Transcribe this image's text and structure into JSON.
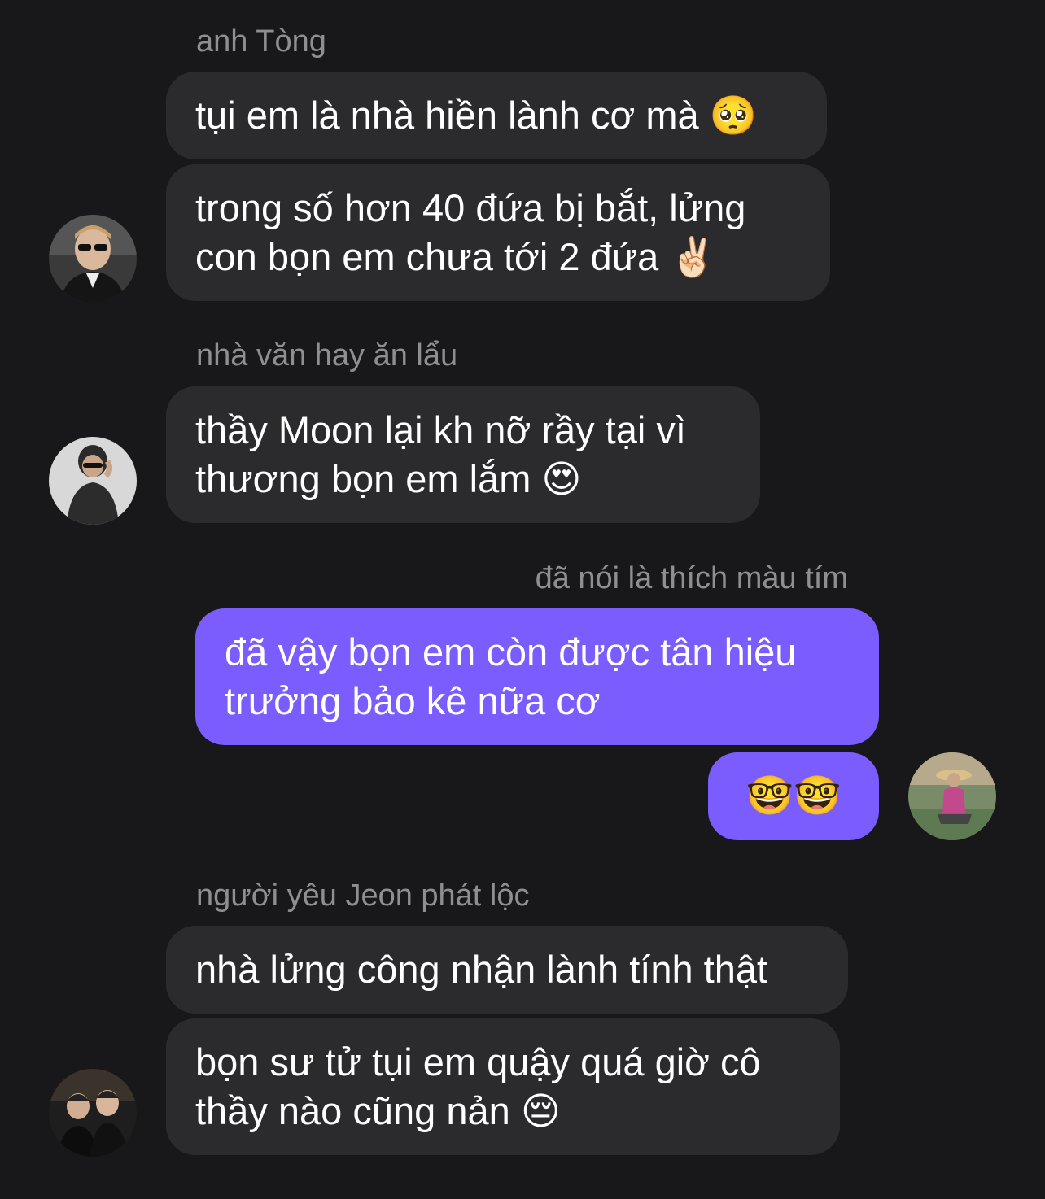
{
  "messages": [
    {
      "sender": "anh Tòng",
      "bubbles": [
        {
          "lines": [
            "tụi em là nhà hiền lành cơ mà 🥺"
          ]
        },
        {
          "lines": [
            "trong số hơn 40 đứa bị bắt, lửng",
            "con bọn em chưa tới 2 đứa ✌🏻"
          ]
        }
      ]
    },
    {
      "sender": "nhà văn hay ăn lẩu",
      "bubbles": [
        {
          "lines": [
            "thầy Moon lại kh nỡ rầy tại vì",
            "thương bọn em lắm 😍"
          ]
        }
      ]
    },
    {
      "sender": "đã nói là thích màu tím",
      "outgoing": true,
      "bubbles": [
        {
          "lines": [
            "đã vậy bọn em còn được tân hiệu",
            "trưởng bảo kê nữa cơ"
          ]
        },
        {
          "lines": [
            "🤓🤓"
          ]
        }
      ]
    },
    {
      "sender": "người yêu Jeon phát lộc",
      "bubbles": [
        {
          "lines": [
            "nhà lửng công nhận lành tính thật"
          ]
        },
        {
          "lines": [
            "bọn sư tử tụi em quậy quá giờ cô",
            "thầy nào cũng nản 😔"
          ]
        }
      ]
    }
  ],
  "colors": {
    "background": "#18181b",
    "incoming_bubble": "#2b2b2e",
    "outgoing_bubble": "#7b5cff",
    "sender_text": "#8e8e93",
    "message_text": "#ffffff"
  }
}
